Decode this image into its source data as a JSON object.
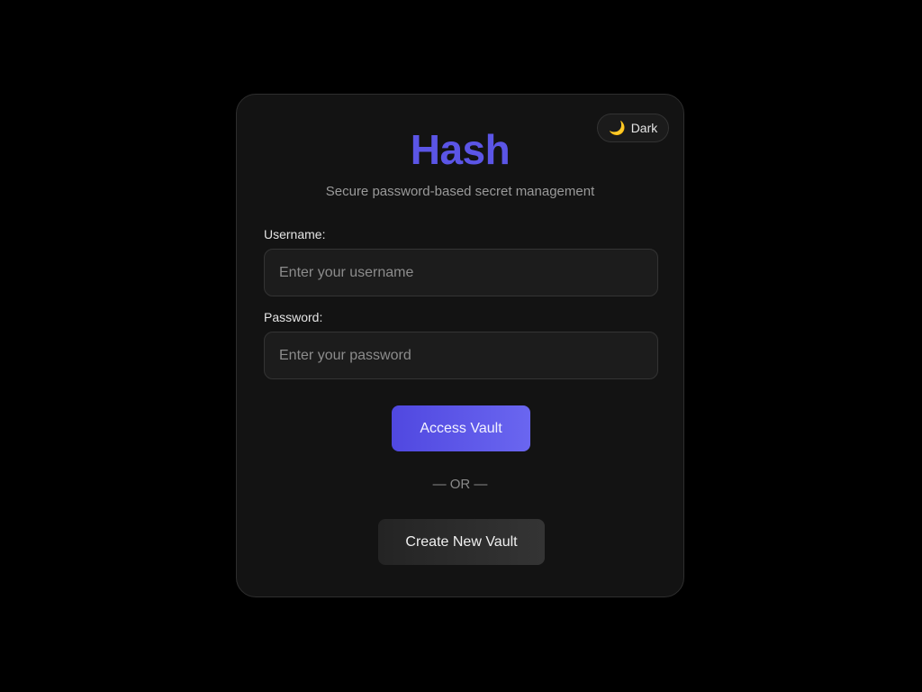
{
  "app": {
    "title": "Hash",
    "subtitle": "Secure password-based secret management"
  },
  "theme_toggle": {
    "icon": "moon-icon",
    "glyph": "🌙",
    "label": "Dark"
  },
  "form": {
    "username": {
      "label": "Username:",
      "placeholder": "Enter your username",
      "value": ""
    },
    "password": {
      "label": "Password:",
      "placeholder": "Enter your password",
      "value": ""
    }
  },
  "actions": {
    "access_label": "Access Vault",
    "divider_text": "— OR —",
    "create_label": "Create New Vault"
  },
  "colors": {
    "background": "#000000",
    "card": "#131313",
    "accent": "#5b55e6",
    "primary_button": "#5a55ea",
    "secondary_button": "#2c2c2c"
  }
}
